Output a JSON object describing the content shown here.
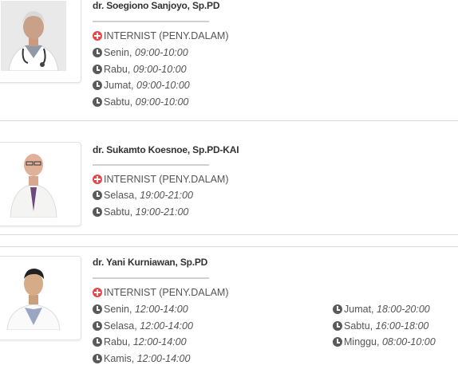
{
  "doctors": [
    {
      "name": "dr. Soegiono Sanjoyo, Sp.PD",
      "specialty": "INTERNIST (PENY.DALAM)",
      "schedule": [
        {
          "day": "Senin,",
          "time": "09:00-10:00"
        },
        {
          "day": "Rabu,",
          "time": "09:00-10:00"
        },
        {
          "day": "Jumat,",
          "time": "09:00-10:00"
        },
        {
          "day": "Sabtu,",
          "time": "09:00-10:00"
        }
      ]
    },
    {
      "name": "dr. Sukamto Koesnoe, Sp.PD-KAI",
      "specialty": "INTERNIST (PENY.DALAM)",
      "schedule": [
        {
          "day": "Selasa,",
          "time": "19:00-21:00"
        },
        {
          "day": "Sabtu,",
          "time": "19:00-21:00"
        }
      ]
    },
    {
      "name": "dr. Yani Kurniawan, Sp.PD",
      "specialty": "INTERNIST (PENY.DALAM)",
      "schedule": [
        {
          "day": "Senin,",
          "time": "12:00-14:00"
        },
        {
          "day": "Selasa,",
          "time": "12:00-14:00"
        },
        {
          "day": "Rabu,",
          "time": "12:00-14:00"
        },
        {
          "day": "Kamis,",
          "time": "12:00-14:00"
        },
        {
          "day": "Jumat,",
          "time": "18:00-20:00"
        },
        {
          "day": "Sabtu,",
          "time": "16:00-18:00"
        },
        {
          "day": "Minggu,",
          "time": "08:00-10:00"
        }
      ]
    }
  ],
  "icons": {
    "specialty": "plus-circle-icon",
    "schedule": "clock-icon"
  },
  "colors": {
    "specialty_icon": "#e8454a",
    "clock_icon": "#5a5a5a"
  }
}
